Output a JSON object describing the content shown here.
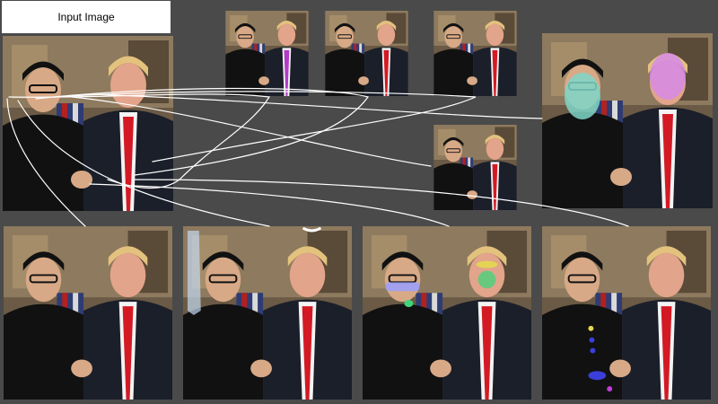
{
  "input_label": "Input Image",
  "colors": {
    "background": "#4a4a4a",
    "links": "#ffffff",
    "purple_tie": "#b23bc6",
    "red_tie": "#d31a24",
    "seg_face_left": "#7fd6c8",
    "seg_face_right": "#d78be6",
    "seg_glasses": "#9aa0ff",
    "seg_mouth": "#3fd67a",
    "seg_hand": "#c3d8f0",
    "dot_yellow": "#e3d94f",
    "dot_blue": "#3b3fd9",
    "dot_purple": "#c23bd9"
  },
  "panels": [
    {
      "id": "input",
      "label": "input-image",
      "tie": "red",
      "overlay": "none"
    },
    {
      "id": "top1",
      "label": "variant-purple-tie",
      "tie": "purple",
      "overlay": "none"
    },
    {
      "id": "top2",
      "label": "variant-red-tie-a",
      "tie": "red",
      "overlay": "none"
    },
    {
      "id": "top3",
      "label": "variant-red-tie-b",
      "tie": "red",
      "overlay": "none"
    },
    {
      "id": "mid",
      "label": "variant-red-tie-c",
      "tie": "red",
      "overlay": "none"
    },
    {
      "id": "right",
      "label": "face-segmentation",
      "tie": "red",
      "overlay": "faces"
    },
    {
      "id": "b1",
      "label": "output-1",
      "tie": "red",
      "overlay": "none"
    },
    {
      "id": "b2",
      "label": "output-2-hand-outline",
      "tie": "red",
      "overlay": "hand"
    },
    {
      "id": "b3",
      "label": "output-3-glasses-mouth",
      "tie": "red",
      "overlay": "glasses"
    },
    {
      "id": "b4",
      "label": "output-4-dots",
      "tie": "red",
      "overlay": "dots"
    }
  ]
}
